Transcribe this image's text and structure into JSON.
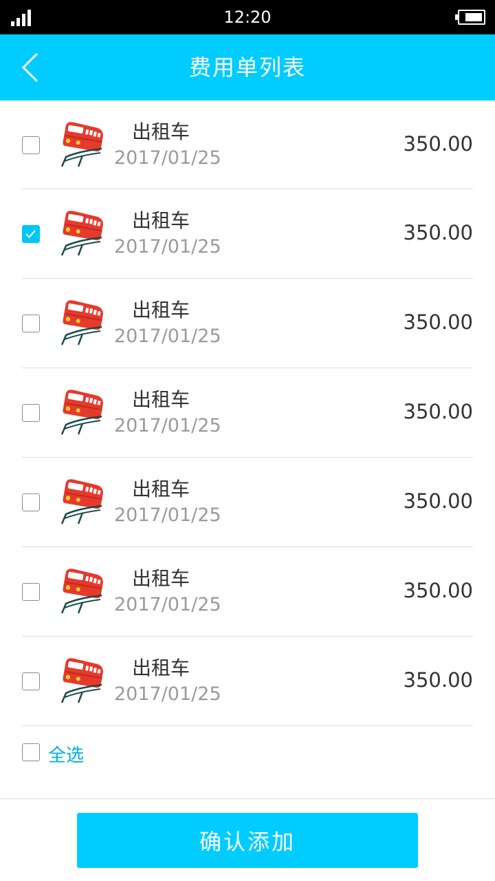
{
  "status_bar": {
    "time": "12:20",
    "battery_level": 0.8
  },
  "header": {
    "title": "费用单列表"
  },
  "colors": {
    "accent": "#00ccff",
    "check": "#00c6f5",
    "icon_red": "#e53a2c"
  },
  "items": [
    {
      "name": "出租车",
      "date": "2017/01/25",
      "amount": "350.00",
      "checked": false,
      "icon": "train-icon"
    },
    {
      "name": "出租车",
      "date": "2017/01/25",
      "amount": "350.00",
      "checked": true,
      "icon": "train-icon"
    },
    {
      "name": "出租车",
      "date": "2017/01/25",
      "amount": "350.00",
      "checked": false,
      "icon": "train-icon"
    },
    {
      "name": "出租车",
      "date": "2017/01/25",
      "amount": "350.00",
      "checked": false,
      "icon": "train-icon"
    },
    {
      "name": "出租车",
      "date": "2017/01/25",
      "amount": "350.00",
      "checked": false,
      "icon": "train-icon"
    },
    {
      "name": "出租车",
      "date": "2017/01/25",
      "amount": "350.00",
      "checked": false,
      "icon": "train-icon"
    },
    {
      "name": "出租车",
      "date": "2017/01/25",
      "amount": "350.00",
      "checked": false,
      "icon": "train-icon"
    }
  ],
  "select_all": {
    "label": "全选",
    "checked": false
  },
  "footer": {
    "confirm_label": "确认添加"
  }
}
